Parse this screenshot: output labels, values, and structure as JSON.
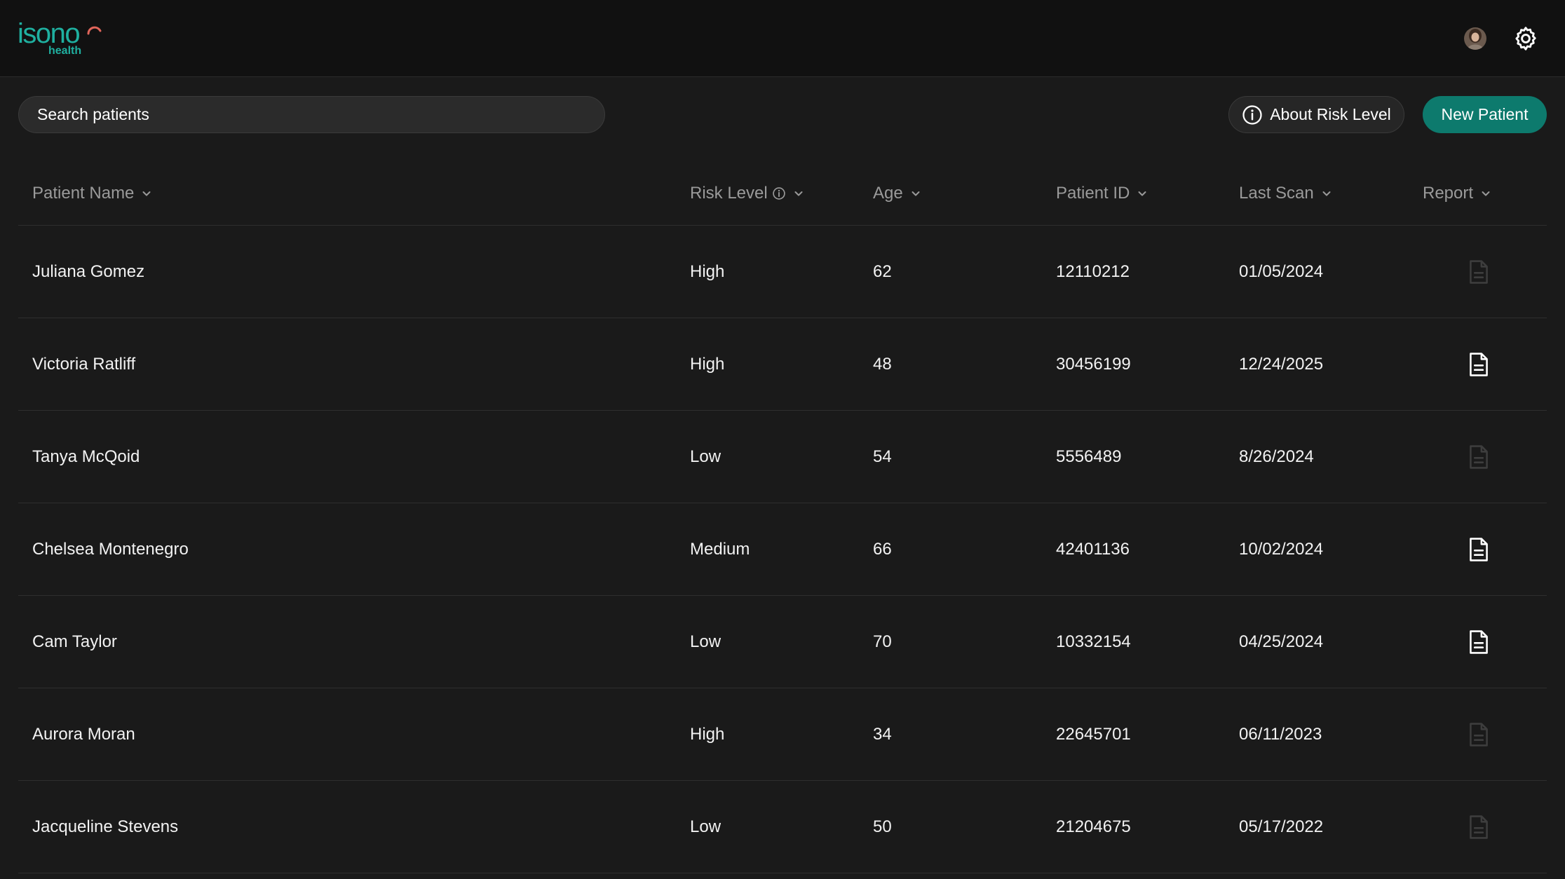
{
  "brand": {
    "name": "isono",
    "sub": "health",
    "color": "#1fb0a0"
  },
  "header": {
    "avatar_icon": "user-avatar",
    "settings_icon": "gear-icon"
  },
  "toolbar": {
    "search_placeholder": "Search patients",
    "about_label": "About Risk Level",
    "new_patient_label": "New Patient",
    "accent": "#0d7a6d"
  },
  "table": {
    "columns": {
      "name": "Patient Name",
      "risk": "Risk Level",
      "age": "Age",
      "id": "Patient ID",
      "scan": "Last Scan",
      "report": "Report"
    },
    "rows": [
      {
        "name": "Juliana Gomez",
        "risk": "High",
        "age": "62",
        "id": "12110212",
        "scan": "01/05/2024",
        "report_available": false
      },
      {
        "name": "Victoria Ratliff",
        "risk": "High",
        "age": "48",
        "id": "30456199",
        "scan": "12/24/2025",
        "report_available": true
      },
      {
        "name": "Tanya McQoid",
        "risk": "Low",
        "age": "54",
        "id": "5556489",
        "scan": "8/26/2024",
        "report_available": false
      },
      {
        "name": "Chelsea Montenegro",
        "risk": "Medium",
        "age": "66",
        "id": "42401136",
        "scan": "10/02/2024",
        "report_available": true
      },
      {
        "name": "Cam Taylor",
        "risk": "Low",
        "age": "70",
        "id": "10332154",
        "scan": "04/25/2024",
        "report_available": true
      },
      {
        "name": "Aurora Moran",
        "risk": "High",
        "age": "34",
        "id": "22645701",
        "scan": "06/11/2023",
        "report_available": false
      },
      {
        "name": "Jacqueline Stevens",
        "risk": "Low",
        "age": "50",
        "id": "21204675",
        "scan": "05/17/2022",
        "report_available": false
      }
    ]
  }
}
